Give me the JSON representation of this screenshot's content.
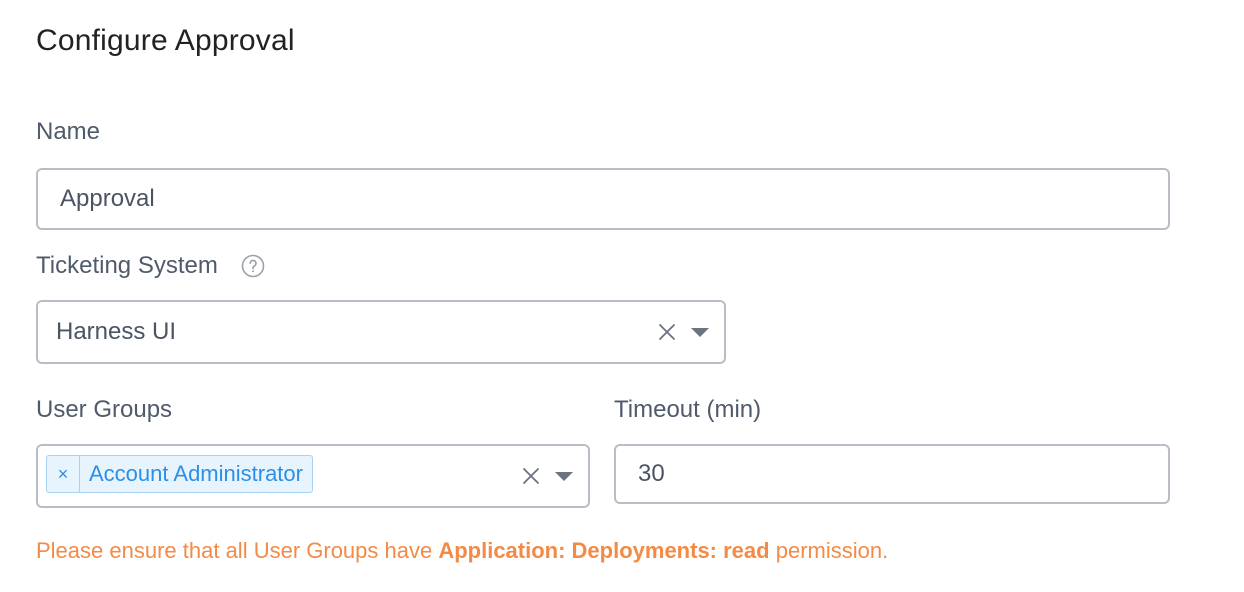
{
  "dialog": {
    "title": "Configure Approval"
  },
  "name_field": {
    "label": "Name",
    "value": "Approval"
  },
  "ticketing": {
    "label": "Ticketing System",
    "value": "Harness UI"
  },
  "user_groups": {
    "label": "User Groups",
    "tags": [
      "Account Administrator"
    ],
    "tag_remove": "×"
  },
  "timeout": {
    "label": "Timeout (min)",
    "value": "30"
  },
  "warning": {
    "prefix": "Please ensure that all User Groups have ",
    "emphasis": "Application: Deployments: read",
    "suffix": " permission."
  },
  "colors": {
    "accent_blue": "#2b8fe5",
    "warning_orange": "#f38a45",
    "border": "#b9bec6"
  },
  "icons": [
    "help-circle-icon",
    "clear-icon",
    "chevron-down-icon",
    "tag-remove-icon"
  ]
}
